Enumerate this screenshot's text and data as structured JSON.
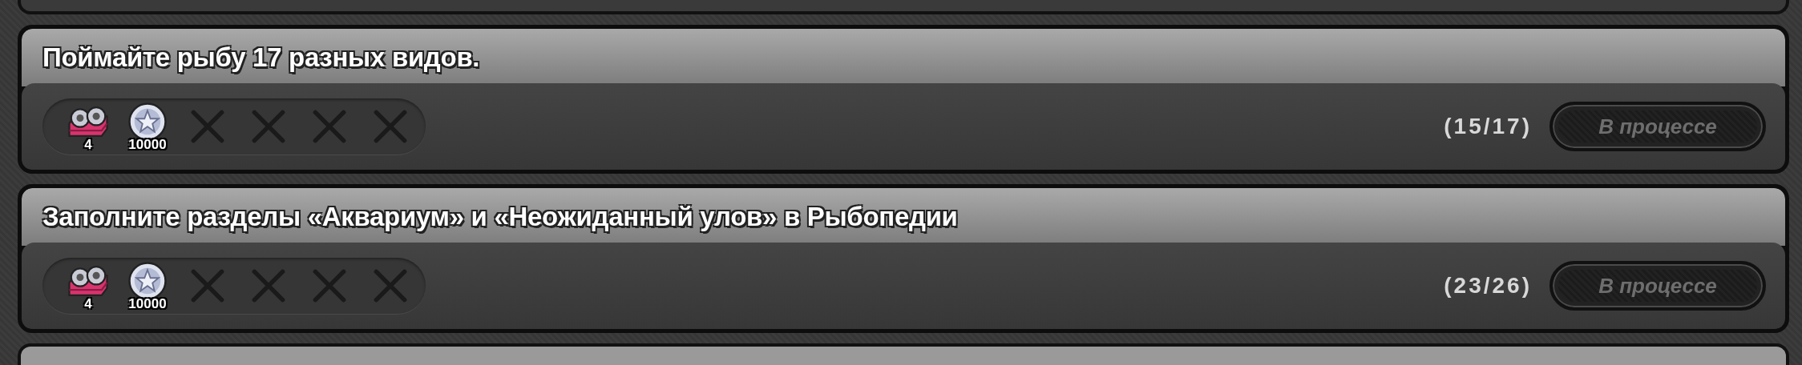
{
  "quests": [
    {
      "title": "Поймайте рыбу 17 разных видов.",
      "rewards": [
        {
          "kind": "reels",
          "amount": "4"
        },
        {
          "kind": "coin",
          "amount": "10000"
        },
        {
          "kind": "empty"
        },
        {
          "kind": "empty"
        },
        {
          "kind": "empty"
        },
        {
          "kind": "empty"
        }
      ],
      "progress": "(15/17)",
      "button": {
        "label": "В процессе",
        "disabled": true
      }
    },
    {
      "title": "Заполните разделы «Аквариум» и «Неожиданный улов» в Рыбопедии",
      "rewards": [
        {
          "kind": "reels",
          "amount": "4"
        },
        {
          "kind": "coin",
          "amount": "10000"
        },
        {
          "kind": "empty"
        },
        {
          "kind": "empty"
        },
        {
          "kind": "empty"
        },
        {
          "kind": "empty"
        }
      ],
      "progress": "(23/26)",
      "button": {
        "label": "В процессе",
        "disabled": true
      }
    }
  ]
}
